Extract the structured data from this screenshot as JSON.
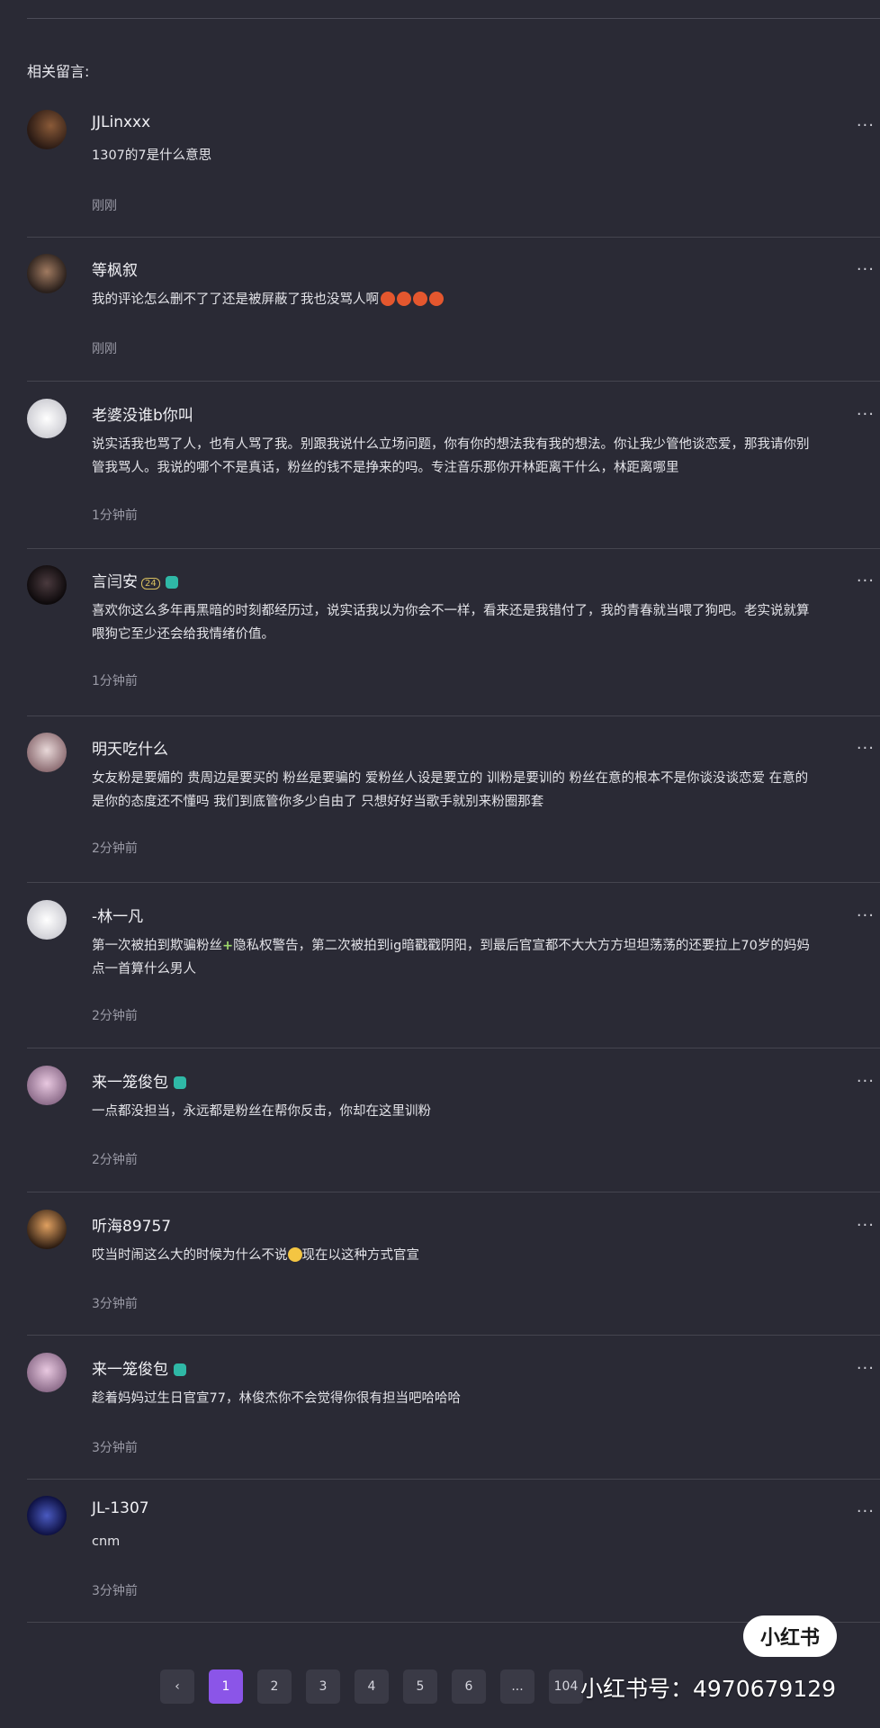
{
  "section_title": "相关留言:",
  "more_icon": "...",
  "comments": [
    {
      "username": "JJLinxxx",
      "content": "1307的7是什么意思",
      "time": "刚刚",
      "avatar_color": "#3b2a20"
    },
    {
      "username": "等枫叙",
      "content": "我的评论怎么删不了了还是被屏蔽了我也没骂人啊",
      "time": "刚刚",
      "avatar_color": "#4a3a32"
    },
    {
      "username": "老婆没谁b你叫",
      "content": "说实话我也骂了人，也有人骂了我。别跟我说什么立场问题，你有你的想法我有我的想法。你让我少管他谈恋爱，那我请你别管我骂人。我说的哪个不是真话，粉丝的钱不是挣来的吗。专注音乐那你开林距离干什么，林距离哪里",
      "time": "1分钟前",
      "avatar_color": "#e8e8ec"
    },
    {
      "username": "言闫安",
      "badge_num": "24",
      "content": "喜欢你这么多年再黑暗的时刻都经历过，说实话我以为你会不一样，看来还是我错付了，我的青春就当喂了狗吧。老实说就算喂狗它至少还会给我情绪价值。",
      "time": "1分钟前",
      "avatar_color": "#1a1416"
    },
    {
      "username": "明天吃什么",
      "content": "女友粉是要媚的 贵周边是要买的 粉丝是要骗的 爱粉丝人设是要立的 训粉是要训的 粉丝在意的根本不是你谈没谈恋爱 在意的是你的态度还不懂吗 我们到底管你多少自由了 只想好好当歌手就别来粉圈那套",
      "time": "2分钟前",
      "avatar_color": "#d8c8c8"
    },
    {
      "username": "-林一凡",
      "content_parts": [
        "第一次被拍到欺骗粉丝",
        "隐私权警告，第二次被拍到ig暗戳戳阴阳，到最后官宣都不大大方方坦坦荡荡的还要拉上70岁的妈妈点一首算什么男人"
      ],
      "time": "2分钟前",
      "avatar_color": "#e8e8ec"
    },
    {
      "username": "来一笼俊包",
      "content": "一点都没担当，永远都是粉丝在帮你反击，你却在这里训粉",
      "time": "2分钟前",
      "avatar_color": "#c9a8c4"
    },
    {
      "username": "听海89757",
      "content_parts": [
        "哎当时闹这么大的时候为什么不说",
        "现在以这种方式官宣"
      ],
      "time": "3分钟前",
      "avatar_color": "#b07a40"
    },
    {
      "username": "来一笼俊包",
      "content": "趁着妈妈过生日官宣77，林俊杰你不会觉得你很有担当吧哈哈哈",
      "time": "3分钟前",
      "avatar_color": "#c9a8c4"
    },
    {
      "username": "JL-1307",
      "content": "cnm",
      "time": "3分钟前",
      "avatar_color": "#1a2a6a"
    }
  ],
  "pagination": {
    "prev": "‹",
    "pages": [
      "1",
      "2",
      "3",
      "4",
      "5",
      "6",
      "...",
      "104"
    ],
    "active": "1"
  },
  "watermark": {
    "logo": "小红书",
    "id": "小红书号：4970679129"
  },
  "colors": {
    "background": "#2a2a35",
    "accent": "#8b55e8",
    "badge": "#2fb8a6"
  }
}
